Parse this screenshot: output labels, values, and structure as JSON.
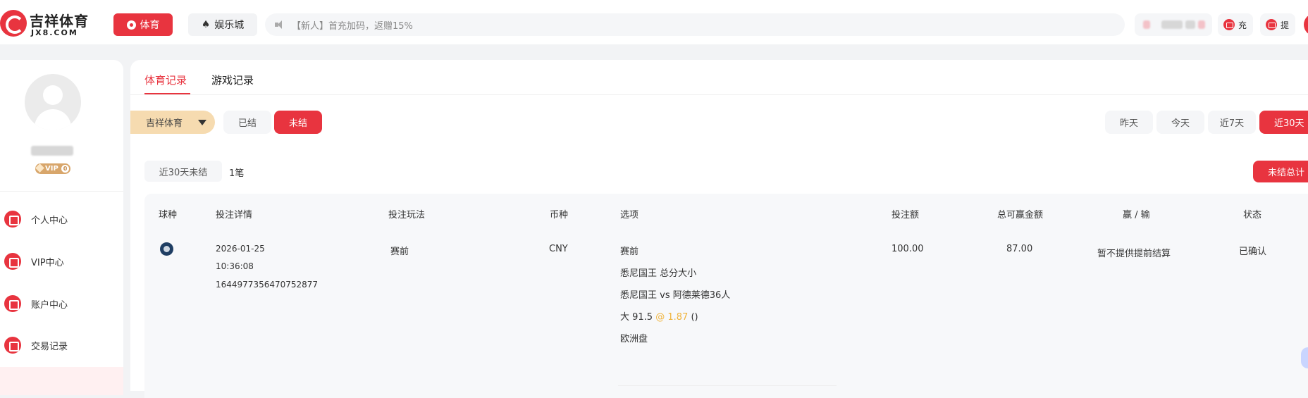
{
  "header": {
    "logo_cn": "吉祥体育",
    "logo_en": "JX8.COM",
    "nav_sport": "体育",
    "nav_casino": "娱乐城",
    "notice": "【新人】首充加码，返赠15%",
    "deposit_label": "充",
    "withdraw_label": "提"
  },
  "sidebar": {
    "vip_badge": "VIP",
    "vip_level": "0",
    "items": [
      {
        "label": "个人中心",
        "icon": "user-icon"
      },
      {
        "label": "VIP中心",
        "icon": "crown-icon"
      },
      {
        "label": "账户中心",
        "icon": "wallet-icon"
      },
      {
        "label": "交易记录",
        "icon": "calendar-icon"
      }
    ]
  },
  "tabs": [
    {
      "label": "体育记录",
      "active": true
    },
    {
      "label": "游戏记录",
      "active": false
    }
  ],
  "filters": {
    "platform": "吉祥体育",
    "status_settled": "已结",
    "status_unsettled": "未结",
    "ranges": [
      "昨天",
      "今天",
      "近7天",
      "近30天"
    ]
  },
  "summary": {
    "label": "近30天未结",
    "count": "1笔",
    "button": "未结总计"
  },
  "table": {
    "headers": {
      "sport": "球种",
      "detail": "投注详情",
      "play": "投注玩法",
      "currency": "币种",
      "option": "选项",
      "stake": "投注额",
      "payout": "总可赢金额",
      "winloss": "赢 / 输",
      "status": "状态"
    },
    "rows": [
      {
        "sport_icon": "basketball-icon",
        "date": "2026-01-25",
        "time": "10:36:08",
        "bet_id": "1644977356470752877",
        "play": "赛前",
        "currency": "CNY",
        "option_type": "赛前",
        "option_market": "悉尼国王 总分大小",
        "option_match": "悉尼国王 vs 阿德莱德36人",
        "option_pick": "大 91.5",
        "option_at": "@",
        "option_odds": "1.87",
        "option_suffix": "()",
        "option_odds_type": "欧洲盘",
        "stake": "100.00",
        "payout": "87.00",
        "winloss": "暂不提供提前结算",
        "status": "已确认"
      }
    ]
  },
  "colors": {
    "accent": "#e8343f",
    "odds": "#f0b43c",
    "platform_bg": "#f6dbb0"
  }
}
